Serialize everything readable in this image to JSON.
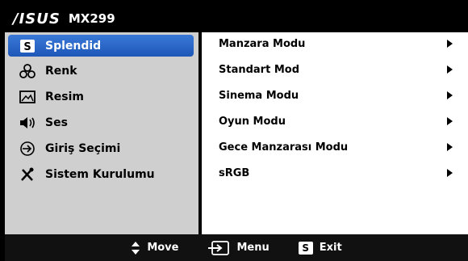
{
  "header": {
    "brand": "/ISUS",
    "model": "MX299"
  },
  "sidebar": {
    "items": [
      {
        "label": "Splendid",
        "icon": "splendid-s-icon",
        "selected": true
      },
      {
        "label": "Renk",
        "icon": "color-icon"
      },
      {
        "label": "Resim",
        "icon": "image-icon"
      },
      {
        "label": "Ses",
        "icon": "speaker-icon"
      },
      {
        "label": "Giriş Seçimi",
        "icon": "input-select-icon"
      },
      {
        "label": "Sistem Kurulumu",
        "icon": "tools-icon"
      }
    ]
  },
  "main": {
    "items": [
      {
        "label": "Manzara Modu"
      },
      {
        "label": "Standart Mod"
      },
      {
        "label": "Sinema Modu"
      },
      {
        "label": "Oyun Modu"
      },
      {
        "label": "Gece Manzarası Modu"
      },
      {
        "label": "sRGB"
      }
    ]
  },
  "footer": {
    "move": "Move",
    "menu": "Menu",
    "exit": "Exit",
    "exit_key": "S"
  },
  "colors": {
    "selected": "#2a67c8",
    "sidebar_bg": "#cfcfcf",
    "panel_bg": "#ffffff",
    "frame": "#000000"
  }
}
